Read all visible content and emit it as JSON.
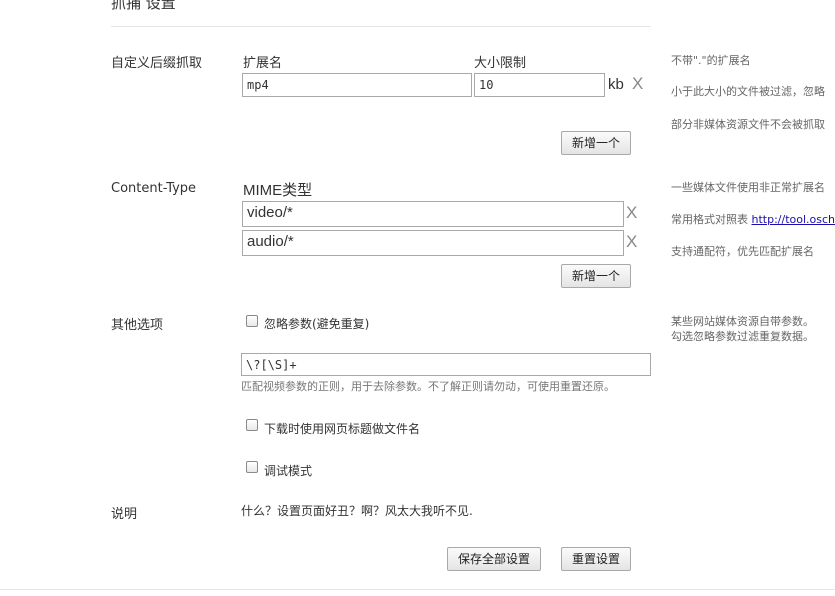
{
  "page": {
    "section_title": "抓捕 设置"
  },
  "suffix": {
    "label": "自定义后缀抓取",
    "col_ext": "扩展名",
    "col_size": "大小限制",
    "ext_value": "mp4",
    "size_value": "10",
    "unit": "kb",
    "remove": "X",
    "add_button": "新增一个",
    "hints": [
      "不带\".\"的扩展名",
      "小于此大小的文件被过滤，忽略",
      "部分非媒体资源文件不会被抓取"
    ]
  },
  "content_type": {
    "label": "Content-Type",
    "col_mime": "MIME类型",
    "rows": [
      {
        "value": "video/*",
        "remove": "X"
      },
      {
        "value": "audio/*",
        "remove": "X"
      }
    ],
    "add_button": "新增一个",
    "hint1": "一些媒体文件使用非正常扩展名",
    "hint2_prefix": "常用格式对照表 ",
    "hint2_link": "http://tool.oschina",
    "hint3": "支持通配符，优先匹配扩展名"
  },
  "other": {
    "label": "其他选项",
    "ignore_params": {
      "label": "忽略参数(避免重复)",
      "checked": false
    },
    "regex_value": "\\?[\\S]+",
    "regex_note": "匹配视频参数的正则，用于去除参数。不了解正则请勿动，可使用重置还原。",
    "use_title": {
      "label": "下载时使用网页标题做文件名",
      "checked": false
    },
    "debug": {
      "label": "调试模式",
      "checked": false
    },
    "hint1": "某些网站媒体资源自带参数。",
    "hint2": "勾选忽略参数过滤重复数据。"
  },
  "explain": {
    "label": "说明",
    "text": "什么？设置页面好丑？啊？风太大我听不见."
  },
  "footer": {
    "save_all": "保存全部设置",
    "reset": "重置设置"
  }
}
